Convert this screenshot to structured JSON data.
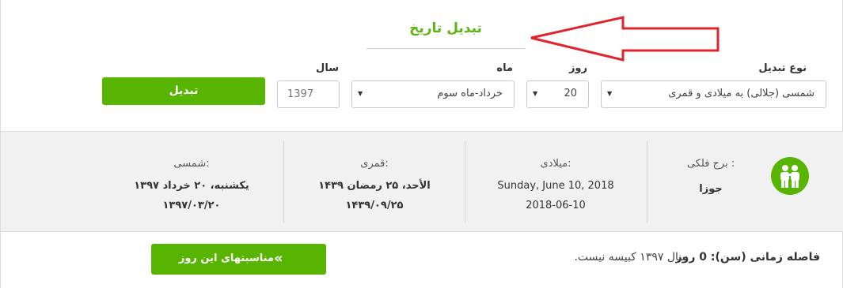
{
  "form": {
    "title": "تبدیل تاریخ",
    "conversion_type_label": "نوع تبدیل",
    "conversion_type_value": "شمسی (جلالی) به میلادی و قمری",
    "day_label": "روز",
    "day_value": "20",
    "month_label": "ماه",
    "month_value": "خرداد-ماه سوم",
    "year_label": "سال",
    "year_placeholder": "1397",
    "convert_button": "تبدیل"
  },
  "results": {
    "zodiac_label": "برج فلکی :",
    "zodiac_value": "جوزا",
    "gregorian_label": "میلادی:",
    "gregorian_long": "Sunday, June 10, 2018",
    "gregorian_short": "2018-06-10",
    "lunar_label": "قمری:",
    "lunar_long": "الأحد، ۲۵ رمضان ۱۴۳۹",
    "lunar_short": "۱۴۳۹/۰۹/۲۵",
    "solar_label": "شمسی:",
    "solar_long": "یکشنبه، ۲۰ خرداد ۱۳۹۷",
    "solar_short": "۱۳۹۷/۰۳/۲۰"
  },
  "footer": {
    "interval_label": "فاصله زمانی (سن): 0 روز",
    "leap_text": "سال ۱۳۹۷ کبیسه نیست.",
    "events_button": "مناسبتهای این روز"
  },
  "colors": {
    "accent": "#57b400",
    "title": "#5cb412",
    "annotation_arrow": "#e0242b"
  },
  "icons": {
    "select_caret": "caret-down-icon",
    "zodiac": "gemini-icon",
    "events_button": "double-chevron-left-icon"
  }
}
